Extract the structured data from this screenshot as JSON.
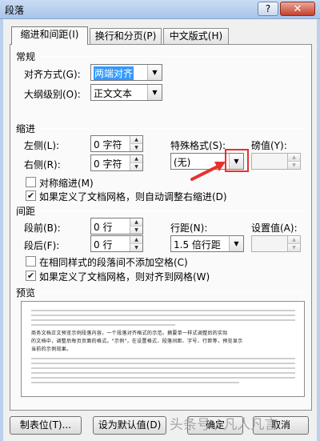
{
  "window": {
    "title": "段落",
    "help": "?",
    "close": "✕"
  },
  "tabs": [
    {
      "label": "缩进和间距(I)",
      "active": true
    },
    {
      "label": "换行和分页(P)",
      "active": false
    },
    {
      "label": "中文版式(H)",
      "active": false
    }
  ],
  "general": {
    "heading": "常规",
    "alignment_label": "对齐方式(G):",
    "alignment_value": "两端对齐",
    "outline_label": "大纲级别(O):",
    "outline_value": "正文文本"
  },
  "indent": {
    "heading": "缩进",
    "left_label": "左侧(L):",
    "left_value": "0 字符",
    "right_label": "右侧(R):",
    "right_value": "0 字符",
    "special_label": "特殊格式(S):",
    "special_value": "(无)",
    "by_label": "磅值(Y):",
    "by_value": "",
    "mirror_label": "对称缩进(M)",
    "mirror_checked": false,
    "auto_adjust_label": "如果定义了文档网格，则自动调整右缩进(D)",
    "auto_adjust_checked": true
  },
  "spacing": {
    "heading": "间距",
    "before_label": "段前(B):",
    "before_value": "0 行",
    "after_label": "段后(F):",
    "after_value": "0 行",
    "line_label": "行距(N):",
    "line_value": "1.5 倍行距",
    "at_label": "设置值(A):",
    "at_value": "",
    "no_space_label": "在相同样式的段落间不添加空格(C)",
    "no_space_checked": false,
    "snap_grid_label": "如果定义了文档网格，则对齐到网格(W)",
    "snap_grid_checked": true
  },
  "preview": {
    "heading": "预览",
    "sample_lines": [
      "商务文档正文预览示例段落内容，一个段落对齐格式的示范。摘要单一样式调整后的实际",
      "的文档中，调整后每页页面的格式。\"示例\"，在设置格式、段落间距、字号、行距等，预览显示",
      "当前的示例效果。"
    ]
  },
  "buttons": {
    "tabs": "制表位(T)...",
    "default": "设为默认值(D)",
    "ok": "确定",
    "cancel": "取消"
  },
  "watermark": "头条号 / 凡人凡言",
  "colors": {
    "highlight": "#e8312c",
    "arrow": "#e8312c",
    "selection": "#3399ff"
  }
}
